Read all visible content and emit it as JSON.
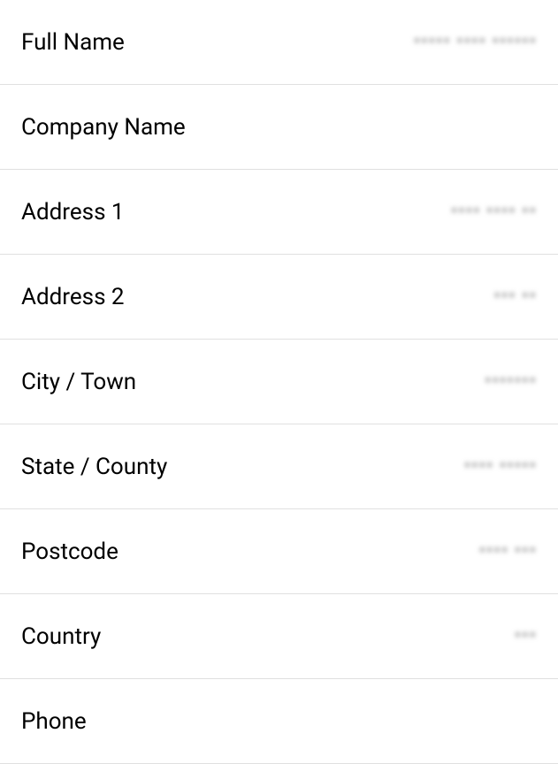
{
  "form": {
    "rows": [
      {
        "label": "Full Name",
        "value": "••••• •••• ••••••",
        "has_value": true
      },
      {
        "label": "Company Name",
        "value": "",
        "has_value": false
      },
      {
        "label": "Address 1",
        "value": "•••• •••• ••",
        "has_value": true
      },
      {
        "label": "Address 2",
        "value": "••• ••",
        "has_value": true
      },
      {
        "label": "City / Town",
        "value": "•••••••",
        "has_value": true
      },
      {
        "label": "State / County",
        "value": "•••• •••••",
        "has_value": true
      },
      {
        "label": "Postcode",
        "value": "•••• •••",
        "has_value": true
      },
      {
        "label": "Country",
        "value": "•••",
        "has_value": true
      },
      {
        "label": "Phone",
        "value": "",
        "has_value": false
      }
    ]
  }
}
